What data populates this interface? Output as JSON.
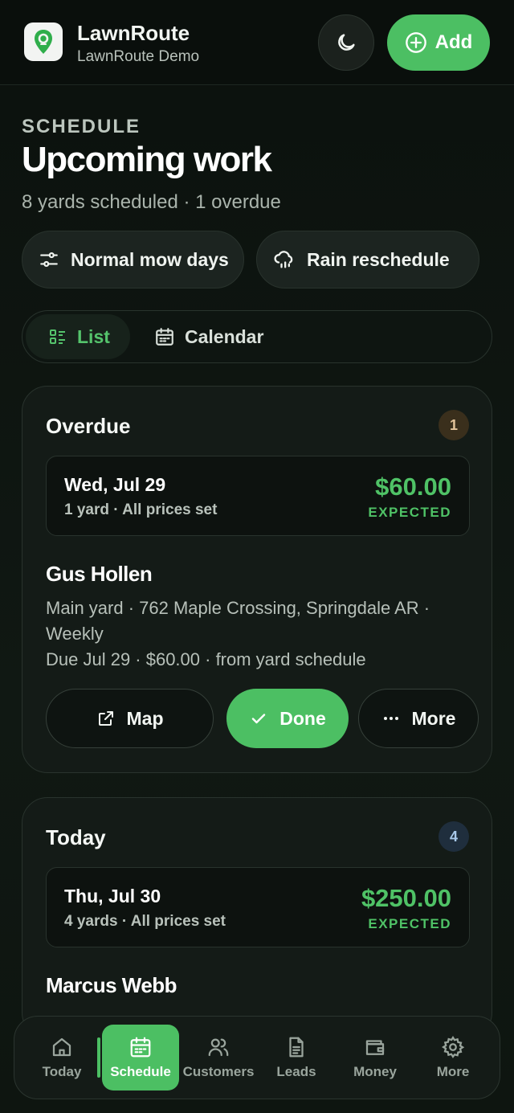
{
  "header": {
    "app_title": "LawnRoute",
    "app_subtitle": "LawnRoute Demo",
    "add_label": "Add",
    "icons": [
      "map-pin-logo-icon",
      "moon-icon",
      "plus-circle-icon"
    ],
    "accent": "#4cbf63"
  },
  "page": {
    "eyebrow": "SCHEDULE",
    "title": "Upcoming work",
    "subtitle": "8 yards scheduled · 1 overdue"
  },
  "filters": {
    "normal_mow": "Normal mow days",
    "rain": "Rain reschedule"
  },
  "view_toggle": {
    "list": "List",
    "calendar": "Calendar",
    "selected": "List"
  },
  "overdue": {
    "title": "Overdue",
    "count": "1",
    "day": {
      "date": "Wed, Jul 29",
      "meta": "1 yard · All prices set",
      "amount": "$60.00",
      "expected": "EXPECTED"
    },
    "customer": {
      "name": "Gus Hollen",
      "address": "Main yard · 762 Maple Crossing, Springdale AR · Weekly",
      "due": "Due Jul 29 · $60.00 · from yard schedule"
    },
    "actions": {
      "map": "Map",
      "done": "Done",
      "more": "More"
    }
  },
  "today": {
    "title": "Today",
    "count": "4",
    "day": {
      "date": "Thu, Jul 30",
      "meta": "4 yards · All prices set",
      "amount": "$250.00",
      "expected": "EXPECTED"
    },
    "customer": {
      "name": "Marcus Webb"
    }
  },
  "tabbar": {
    "tabs": [
      {
        "label": "Today",
        "icon": "home-icon"
      },
      {
        "label": "Schedule",
        "icon": "calendar-icon"
      },
      {
        "label": "Customers",
        "icon": "users-icon"
      },
      {
        "label": "Leads",
        "icon": "document-icon"
      },
      {
        "label": "Money",
        "icon": "wallet-icon"
      },
      {
        "label": "More",
        "icon": "gear-icon"
      }
    ],
    "active": "Schedule"
  }
}
